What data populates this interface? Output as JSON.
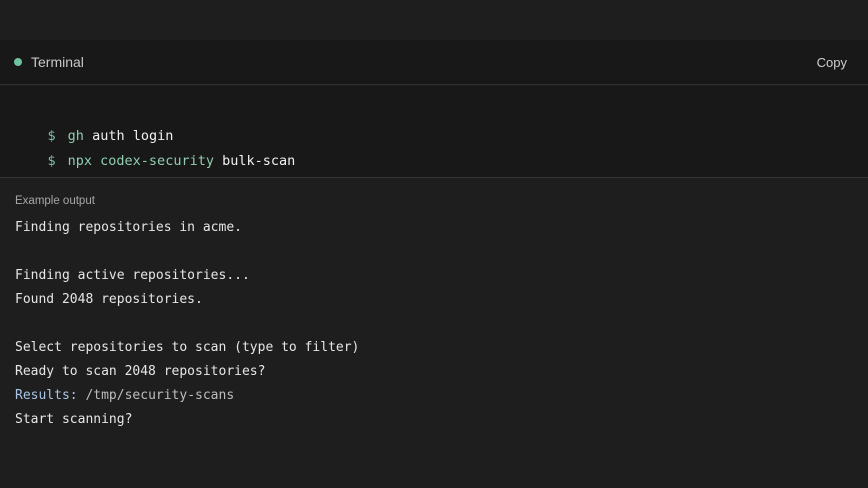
{
  "header": {
    "title": "Terminal",
    "copy_label": "Copy",
    "status_color": "#6fc2a0"
  },
  "commands": [
    {
      "prompt": "$",
      "cmd": "gh",
      "args": "auth login"
    },
    {
      "prompt": "$",
      "cmd": "npx codex-security",
      "args": "bulk-scan"
    }
  ],
  "output": {
    "label": "Example output",
    "lines": [
      "Finding repositories in acme.",
      "",
      "Finding active repositories...",
      "Found 2048 repositories.",
      "",
      "Select repositories to scan (type to filter)",
      "Ready to scan 2048 repositories?"
    ],
    "results_key": "Results:",
    "results_value": "/tmp/security-scans",
    "final_line": "Start scanning?"
  }
}
